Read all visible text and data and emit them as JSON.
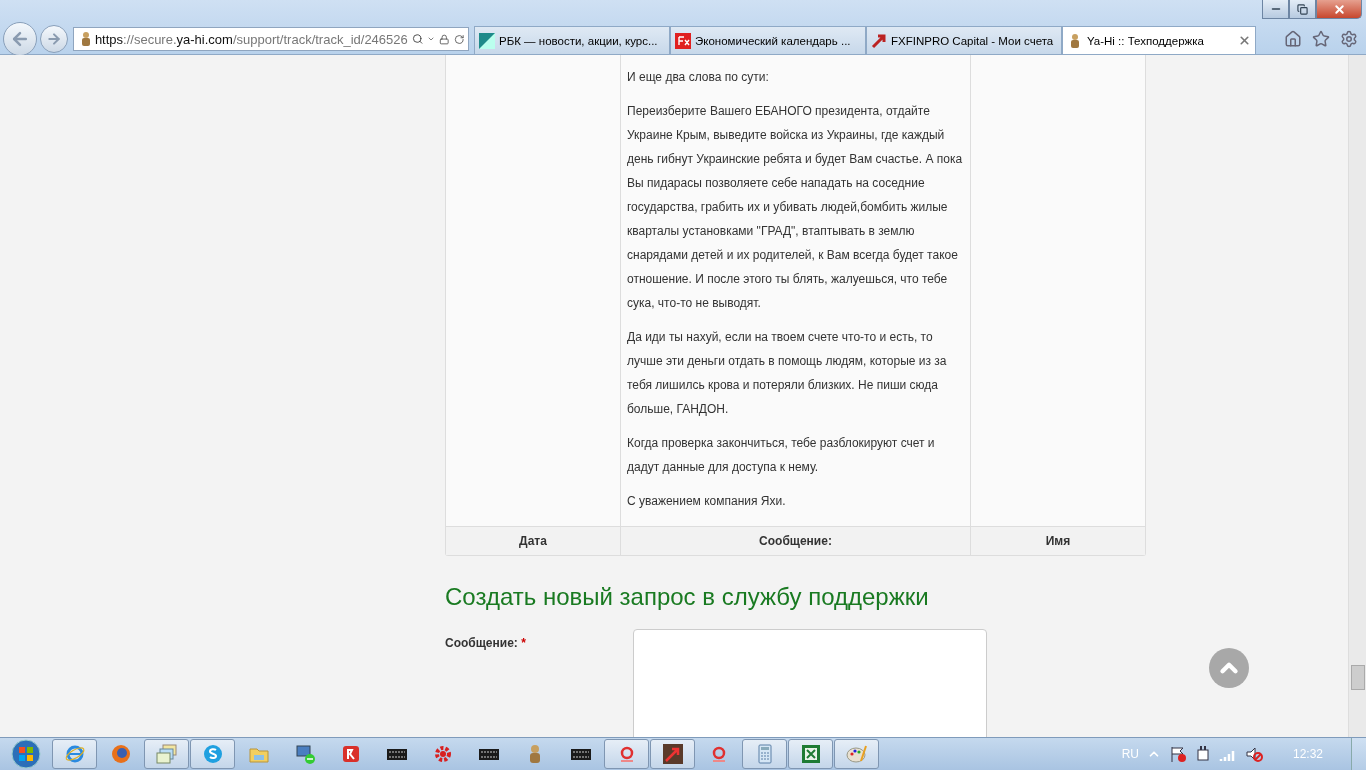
{
  "browser": {
    "url": {
      "prefix": "https://secure.",
      "domain": "ya-hi.com",
      "path": "/support/track/track_id/246526"
    },
    "tabs": [
      {
        "title": "РБК — новости, акции, курс...",
        "kind": "rbc",
        "selected": false
      },
      {
        "title": "Экономический календарь ...",
        "kind": "fx",
        "selected": false
      },
      {
        "title": "FXFINPRO Capital - Мои счета",
        "kind": "arrow",
        "selected": false
      },
      {
        "title": "Ya-Hi :: Техподдержка",
        "kind": "figure",
        "selected": true
      }
    ]
  },
  "ticket_table": {
    "message_paragraphs": [
      "И еще два слова по сути:",
      "Переизберите Вашего ЕБАНОГО президента, отдайте Украине Крым, выведите войска из Украины, где каждый день гибнут Украинские ребята и будет Вам счастье. А пока Вы пидарасы позволяете себе нападать на соседние государства, грабить их и убивать людей,бомбить жилые кварталы установками \"ГРАД\", втаптывать в землю снарядами детей и их родителей, к Вам всегда будет такое отношение. И после этого ты блять, жалуешься, что тебе сука, что-то не выводят.",
      "Да иди  ты нахуй, если на твоем счете что-то и есть, то лучше эти деньги отдать в помощь людям, которые из за тебя лишилсь крова и потеряли близких. Не пиши сюда больше, ГАНДОН.",
      "Когда проверка закончиться, тебе разблокируют счет и дадут данные для доступа к нему.",
      "С уважением компания Яхи."
    ],
    "columns": [
      "Дата",
      "Сообщение:",
      "Имя"
    ]
  },
  "new_request": {
    "heading": "Создать новый запрос в службу поддержки",
    "fields": [
      {
        "label": "Сообщение:",
        "required_mark": "*"
      }
    ]
  },
  "taskbar": {
    "items": [
      {
        "kind": "ie",
        "open": true
      },
      {
        "kind": "firefox",
        "open": false
      },
      {
        "kind": "windows",
        "open": true
      },
      {
        "kind": "skype",
        "open": true
      },
      {
        "kind": "folder",
        "open": false
      },
      {
        "kind": "network",
        "open": false
      },
      {
        "kind": "r-app",
        "open": false
      },
      {
        "kind": "mt4",
        "open": false
      },
      {
        "kind": "gear",
        "open": false
      },
      {
        "kind": "mt4",
        "open": false
      },
      {
        "kind": "figure",
        "open": false
      },
      {
        "kind": "mt4",
        "open": false
      },
      {
        "kind": "g-app",
        "open": true
      },
      {
        "kind": "arrow",
        "open": true
      },
      {
        "kind": "g-app",
        "open": false
      },
      {
        "kind": "calculator",
        "open": true
      },
      {
        "kind": "excel",
        "open": true
      },
      {
        "kind": "paint",
        "open": true
      }
    ],
    "tray": {
      "language": "RU",
      "clock": "12:32"
    }
  }
}
